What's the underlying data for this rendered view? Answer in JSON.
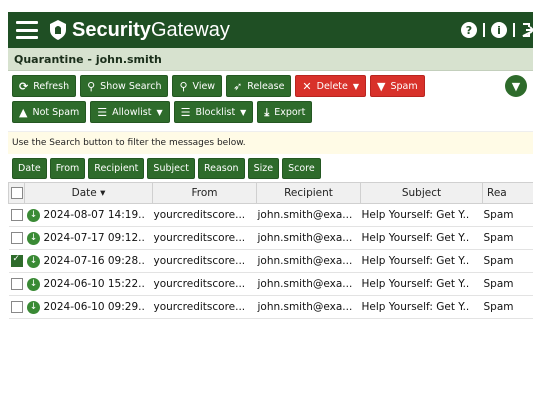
{
  "header": {
    "brand_bold": "Security",
    "brand_light": "Gateway",
    "help_icon": "?",
    "info_icon": "i"
  },
  "page": {
    "title": "Quarantine - john.smith"
  },
  "toolbar": {
    "refresh": "Refresh",
    "show_search": "Show Search",
    "view": "View",
    "release": "Release",
    "delete": "Delete",
    "spam": "Spam",
    "not_spam": "Not Spam",
    "allowlist": "Allowlist",
    "blocklist": "Blocklist",
    "export": "Export"
  },
  "hint": "Use the Search button to filter the messages below.",
  "filters": [
    "Date",
    "From",
    "Recipient",
    "Subject",
    "Reason",
    "Size",
    "Score"
  ],
  "table": {
    "columns": [
      "Date ▾",
      "From",
      "Recipient",
      "Subject",
      "Rea"
    ],
    "rows": [
      {
        "date": "2024-08-07 14:19..",
        "from": "yourcreditscore...",
        "recipient": "john.smith@exa...",
        "subject": "Help Yourself: Get Y..",
        "reason": "Spam",
        "checked": false
      },
      {
        "date": "2024-07-17 09:12..",
        "from": "yourcreditscore...",
        "recipient": "john.smith@exa...",
        "subject": "Help Yourself: Get Y..",
        "reason": "Spam",
        "checked": false
      },
      {
        "date": "2024-07-16 09:28..",
        "from": "yourcreditscore...",
        "recipient": "john.smith@exa...",
        "subject": "Help Yourself: Get Y..",
        "reason": "Spam",
        "checked": true
      },
      {
        "date": "2024-06-10 15:22..",
        "from": "yourcreditscore...",
        "recipient": "john.smith@exa...",
        "subject": "Help Yourself: Get Y..",
        "reason": "Spam",
        "checked": false
      },
      {
        "date": "2024-06-10 09:29..",
        "from": "yourcreditscore...",
        "recipient": "john.smith@exa...",
        "subject": "Help Yourself: Get Y..",
        "reason": "Spam",
        "checked": false
      }
    ]
  },
  "colors": {
    "header": "#1f4f24",
    "button": "#2e6b2b",
    "danger": "#d8312a",
    "titlebar": "#d7e2cf",
    "hint": "#fffbe6"
  }
}
